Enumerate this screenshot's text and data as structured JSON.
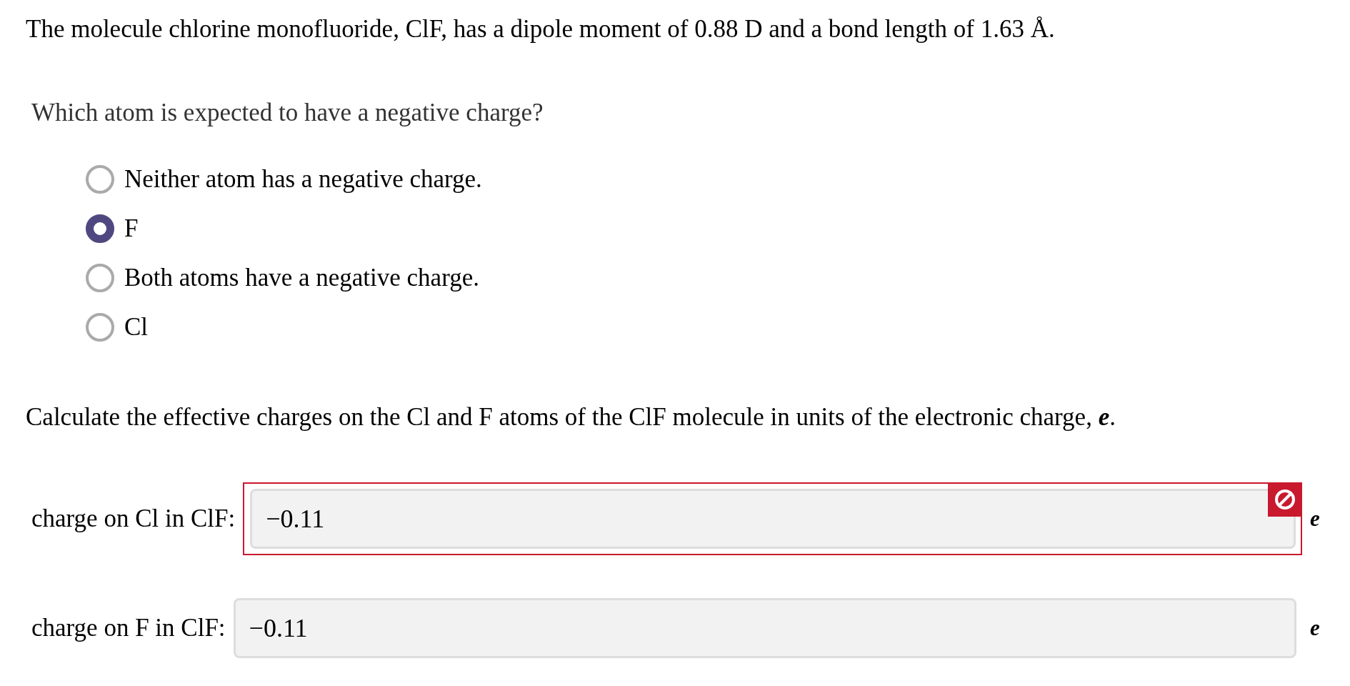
{
  "intro": "The molecule chlorine monofluoride, ClF, has a dipole moment of 0.88 D and a bond length of 1.63 Å.",
  "question": {
    "prompt": "Which atom is expected to have a negative charge?",
    "options": [
      {
        "label": "Neither atom has a negative charge.",
        "selected": false
      },
      {
        "label": "F",
        "selected": true
      },
      {
        "label": "Both atoms have a negative charge.",
        "selected": false
      },
      {
        "label": "Cl",
        "selected": false
      }
    ]
  },
  "calculation": {
    "prompt": "Calculate the effective charges on the Cl and F atoms of the ClF molecule in units of the electronic charge, *e*.",
    "fields": [
      {
        "label": "charge on Cl in ClF:",
        "value": "−0.11",
        "unit": "e",
        "incorrect": true
      },
      {
        "label": "charge on F in ClF:",
        "value": "−0.11",
        "unit": "e",
        "incorrect": false
      }
    ]
  }
}
